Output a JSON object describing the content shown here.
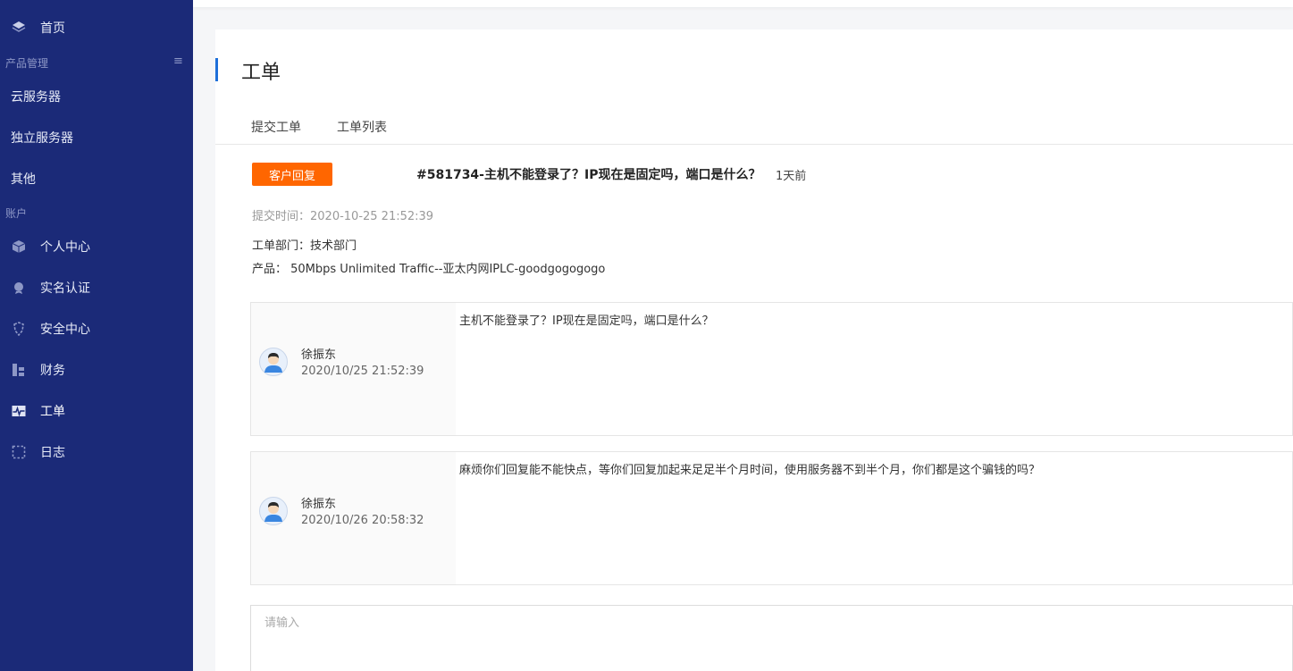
{
  "sidebar": {
    "home": {
      "label": "首页",
      "icon": "cube-layers-icon"
    },
    "section_product": {
      "title": "产品管理",
      "toggle": "≡"
    },
    "products": [
      {
        "label": "云服务器"
      },
      {
        "label": "独立服务器"
      },
      {
        "label": "其他"
      }
    ],
    "section_account": {
      "title": "账户"
    },
    "account_items": [
      {
        "label": "个人中心",
        "icon": "box-icon"
      },
      {
        "label": "实名认证",
        "icon": "verified-badge-icon"
      },
      {
        "label": "安全中心",
        "icon": "shield-icon"
      },
      {
        "label": "财务",
        "icon": "finance-icon"
      },
      {
        "label": "工单",
        "icon": "pulse-icon",
        "active": true
      },
      {
        "label": "日志",
        "icon": "log-icon"
      }
    ],
    "colors": {
      "bg": "#1b2a78",
      "active_text": "#ffffff",
      "muted": "#8d97c6"
    }
  },
  "page": {
    "title": "工单",
    "accent": "#1e6fd9",
    "tabs": [
      {
        "label": "提交工单"
      },
      {
        "label": "工单列表"
      }
    ]
  },
  "ticket": {
    "status_badge": "客户回复",
    "status_color": "#ff6600",
    "title": "#581734-主机不能登录了？IP现在是固定吗，端口是什么？",
    "ago": "1天前",
    "submit_time": "提交时间：2020-10-25 21:52:39",
    "department": "工单部门：技术部门",
    "product": "产品：  50Mbps Unlimited Traffic--亚太内网IPLC-goodgogogogo"
  },
  "messages": [
    {
      "author": "徐振东",
      "time": "2020/10/25 21:52:39",
      "content": "主机不能登录了？IP现在是固定吗，端口是什么？"
    },
    {
      "author": "徐振东",
      "time": "2020/10/26 20:58:32",
      "content": "麻烦你们回复能不能快点，等你们回复加起来足足半个月时间，使用服务器不到半个月，你们都是这个骗钱的吗？"
    }
  ],
  "reply": {
    "placeholder": "请输入",
    "value": ""
  }
}
